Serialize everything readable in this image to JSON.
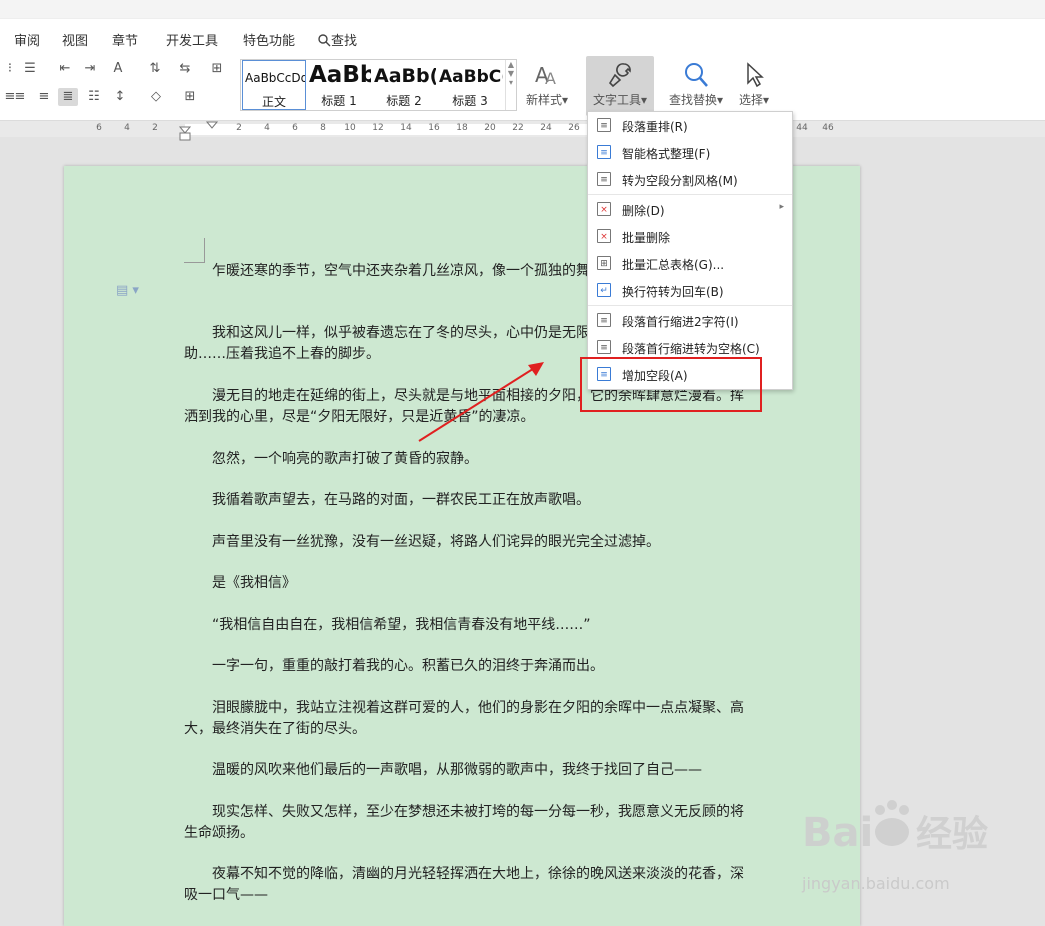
{
  "tabs": [
    "审阅",
    "视图",
    "章节",
    "开发工具",
    "特色功能",
    "查找"
  ],
  "styles": [
    {
      "sample": "AaBbCcDd",
      "name": "正文"
    },
    {
      "sample": "AaBb",
      "name": "标题 1"
    },
    {
      "sample": "AaBb(",
      "name": "标题 2"
    },
    {
      "sample": "AaBbC(",
      "name": "标题 3"
    }
  ],
  "ribbon_buttons": {
    "new_style": "新样式",
    "text_tools": "文字工具",
    "find_replace": "查找替换",
    "select": "选择"
  },
  "ruler_ticks": [
    "6",
    "4",
    "2",
    "2",
    "4",
    "6",
    "8",
    "10",
    "12",
    "14",
    "16",
    "18",
    "20",
    "22",
    "24",
    "26",
    "28",
    "44",
    "46"
  ],
  "menu_items": [
    {
      "label": "段落重排(R)",
      "icon": "paragraph-rearrange-icon"
    },
    {
      "label": "智能格式整理(F)",
      "icon": "smart-format-icon"
    },
    {
      "label": "转为空段分割风格(M)",
      "icon": "split-style-icon"
    },
    {
      "label": "删除(D)",
      "icon": "delete-icon",
      "submenu": true
    },
    {
      "label": "批量删除",
      "icon": "batch-delete-icon"
    },
    {
      "label": "批量汇总表格(G)...",
      "icon": "batch-table-icon"
    },
    {
      "label": "换行符转为回车(B)",
      "icon": "linebreak-icon"
    },
    {
      "label": "段落首行缩进2字符(I)",
      "icon": "indent-icon"
    },
    {
      "label": "段落首行缩进转为空格(C)",
      "icon": "indent-space-icon"
    },
    {
      "label": "增加空段(A)",
      "icon": "add-empty-paragraph-icon"
    }
  ],
  "paragraphs": [
    "乍暖还寒的季节，空气中还夹杂着几丝凉风，像一个孤独的舞者，属于她的舞台上。",
    "我和这风儿一样，似乎被春遗忘在了冬的尽头，心中仍是无限里的负担、青春的无助……压着我追不上春的脚步。",
    "漫无目的地走在延绵的街上，尽头就是与地平面相接的夕阳，它的余晖肆意烂漫着。挥洒到我的心里，尽是“夕阳无限好，只是近黄昏”的凄凉。",
    "忽然，一个响亮的歌声打破了黄昏的寂静。",
    "我循着歌声望去，在马路的对面，一群农民工正在放声歌唱。",
    "声音里没有一丝犹豫，没有一丝迟疑，将路人们诧异的眼光完全过滤掉。",
    "是《我相信》",
    "“我相信自由自在，我相信希望，我相信青春没有地平线……”",
    "一字一句，重重的敲打着我的心。积蓄已久的泪终于奔涌而出。",
    "泪眼朦胧中，我站立注视着这群可爱的人，他们的身影在夕阳的余晖中一点点凝聚、高大，最终消失在了街的尽头。",
    "温暖的风吹来他们最后的一声歌唱，从那微弱的歌声中，我终于找回了自己——",
    "现实怎样、失败又怎样，至少在梦想还未被打垮的每一分每一秒，我愿意义无反顾的将生命颂扬。",
    "夜幕不知不觉的降临，清幽的月光轻轻挥洒在大地上，徐徐的晚风送来淡淡的花香，深吸一口气——"
  ],
  "watermark": {
    "brand": "Baidu经验",
    "url": "jingyan.baidu.com"
  },
  "colors": {
    "page_bg": "#cde8d1",
    "highlight": "#e02020",
    "arrow": "#e02020"
  }
}
